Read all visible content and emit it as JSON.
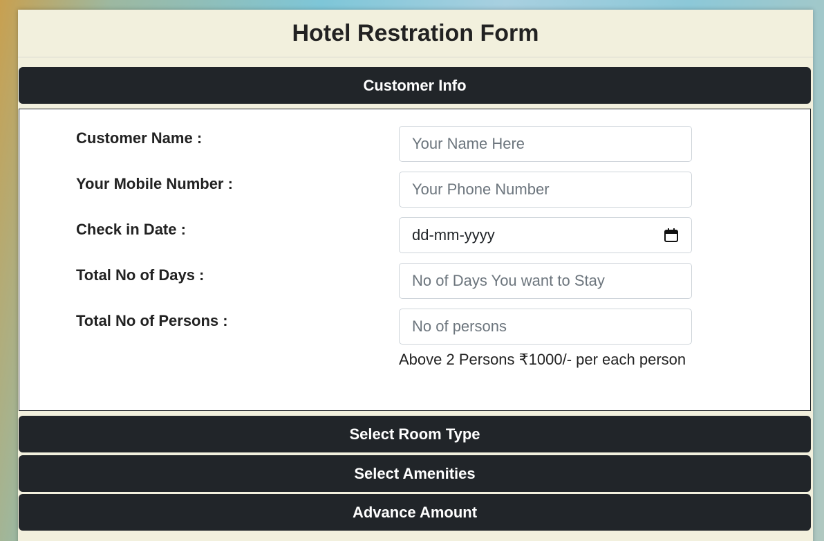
{
  "form": {
    "title": "Hotel Restration Form"
  },
  "sections": {
    "customer_info": "Customer Info",
    "room_type": "Select Room Type",
    "amenities": "Select Amenities",
    "advance": "Advance Amount"
  },
  "fields": {
    "name": {
      "label": "Customer Name :",
      "placeholder": "Your Name Here"
    },
    "mobile": {
      "label": "Your Mobile Number :",
      "placeholder": "Your Phone Number"
    },
    "checkin": {
      "label": "Check in Date :",
      "value": "dd-mm-yyyy",
      "icon": "calendar-icon"
    },
    "days": {
      "label": "Total No of Days :",
      "placeholder": "No of Days You want to Stay"
    },
    "persons": {
      "label": "Total No of Persons :",
      "placeholder": "No of persons"
    }
  },
  "note": "Above 2 Persons ₹1000/- per each person"
}
